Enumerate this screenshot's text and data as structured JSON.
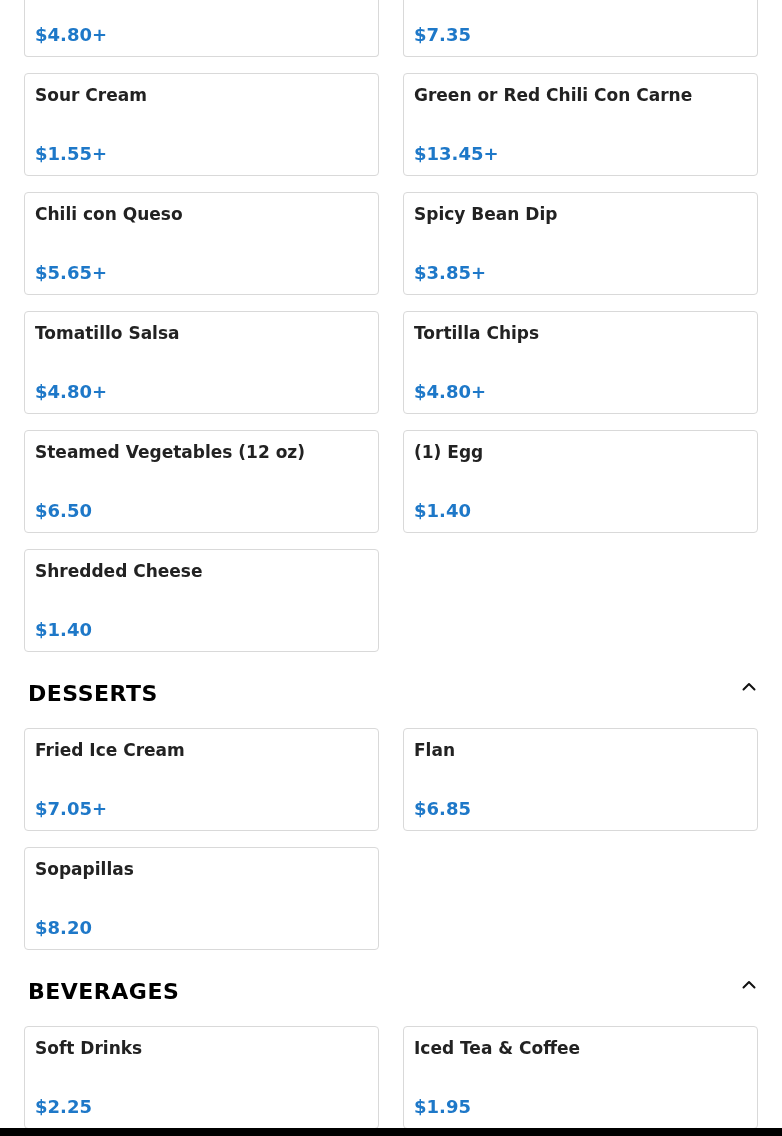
{
  "sections": [
    {
      "items": [
        {
          "price": "$4.80+"
        },
        {
          "price": "$7.35"
        },
        {
          "name": "Sour Cream",
          "price": "$1.55+"
        },
        {
          "name": "Green or Red Chili Con Carne",
          "price": "$13.45+"
        },
        {
          "name": "Chili con Queso",
          "price": "$5.65+"
        },
        {
          "name": "Spicy Bean Dip",
          "price": "$3.85+"
        },
        {
          "name": "Tomatillo Salsa",
          "price": "$4.80+"
        },
        {
          "name": "Tortilla Chips",
          "price": "$4.80+"
        },
        {
          "name": "Steamed Vegetables (12 oz)",
          "price": "$6.50"
        },
        {
          "name": "(1) Egg",
          "price": "$1.40"
        },
        {
          "name": "Shredded Cheese",
          "price": "$1.40"
        }
      ]
    },
    {
      "title": "DESSERTS",
      "expanded": true,
      "items": [
        {
          "name": "Fried Ice Cream",
          "price": "$7.05+"
        },
        {
          "name": "Flan",
          "price": "$6.85"
        },
        {
          "name": "Sopapillas",
          "price": "$8.20"
        }
      ]
    },
    {
      "title": "BEVERAGES",
      "expanded": true,
      "items": [
        {
          "name": "Soft Drinks",
          "price": "$2.25"
        },
        {
          "name": "Iced Tea & Coffee",
          "price": "$1.95"
        }
      ]
    }
  ]
}
